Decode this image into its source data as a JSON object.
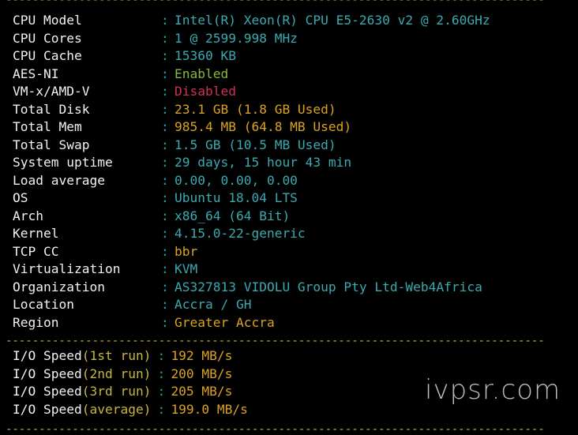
{
  "separator": "--------------------------------------------------------------------------------------------------------------------",
  "rows": [
    {
      "label": "CPU Model",
      "value": "Intel(R) Xeon(R) CPU E5-2630 v2 @ 2.60GHz",
      "color": "#3aaab0"
    },
    {
      "label": "CPU Cores",
      "value": "1 @ 2599.998 MHz",
      "color": "#3aaab0"
    },
    {
      "label": "CPU Cache",
      "value": "15360 KB",
      "color": "#3aaab0"
    },
    {
      "label": "AES-NI",
      "value": "Enabled",
      "color": "#8cb63a"
    },
    {
      "label": "VM-x/AMD-V",
      "value": "Disabled",
      "color": "#d0305a"
    },
    {
      "label": "Total Disk",
      "value": "23.1 GB (1.8 GB Used)",
      "color": "#d9a31f"
    },
    {
      "label": "Total Mem",
      "value": "985.4 MB (64.8 MB Used)",
      "color": "#d9a31f"
    },
    {
      "label": "Total Swap",
      "value": "1.5 GB (10.5 MB Used)",
      "color": "#3aaab0"
    },
    {
      "label": "System uptime",
      "value": "29 days, 15 hour 43 min",
      "color": "#3aaab0"
    },
    {
      "label": "Load average",
      "value": "0.00, 0.00, 0.00",
      "color": "#3aaab0"
    },
    {
      "label": "OS",
      "value": "Ubuntu 18.04 LTS",
      "color": "#3aaab0"
    },
    {
      "label": "Arch",
      "value": "x86_64 (64 Bit)",
      "color": "#3aaab0"
    },
    {
      "label": "Kernel",
      "value": "4.15.0-22-generic",
      "color": "#3aaab0"
    },
    {
      "label": "TCP CC",
      "value": "bbr",
      "color": "#d9a31f"
    },
    {
      "label": "Virtualization",
      "value": "KVM",
      "color": "#3aaab0"
    },
    {
      "label": "Organization",
      "value": "AS327813 VIDOLU Group Pty Ltd-Web4Africa",
      "color": "#3aaab0"
    },
    {
      "label": "Location",
      "value": "Accra / GH",
      "color": "#3aaab0"
    },
    {
      "label": "Region",
      "value": "Greater Accra",
      "color": "#d9a31f"
    }
  ],
  "io": [
    {
      "prefix": "I/O Speed",
      "paren": "(1st run)",
      "value": "192 MB/s"
    },
    {
      "prefix": "I/O Speed",
      "paren": "(2nd run)",
      "value": "200 MB/s"
    },
    {
      "prefix": "I/O Speed",
      "paren": "(3rd run)",
      "value": "205 MB/s"
    },
    {
      "prefix": "I/O Speed",
      "paren": "(average)",
      "value": "199.0 MB/s"
    }
  ],
  "colon": ":",
  "watermark": "ivpsr.com"
}
